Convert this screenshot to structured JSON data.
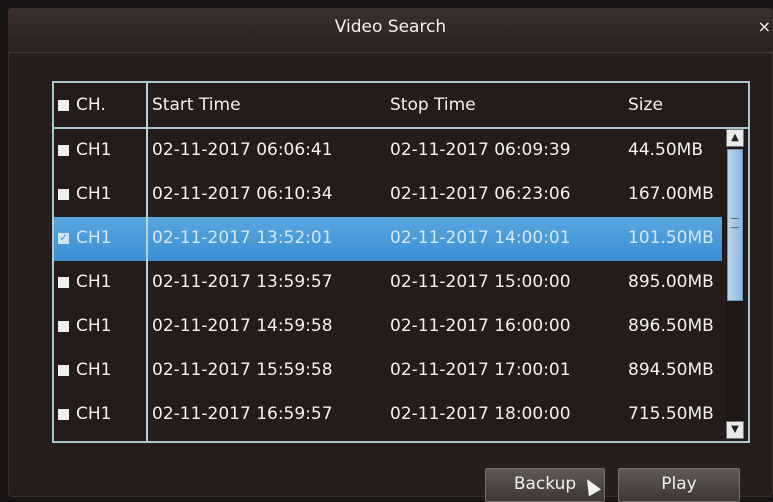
{
  "dialog": {
    "title": "Video Search",
    "close_icon": "×"
  },
  "table": {
    "headers": {
      "channel": "CH.",
      "start": "Start Time",
      "stop": "Stop Time",
      "size": "Size"
    },
    "rows": [
      {
        "channel": "CH1",
        "start": "02-11-2017 06:06:41",
        "stop": "02-11-2017 06:09:39",
        "size": "44.50MB",
        "checked": false
      },
      {
        "channel": "CH1",
        "start": "02-11-2017 06:10:34",
        "stop": "02-11-2017 06:23:06",
        "size": "167.00MB",
        "checked": false
      },
      {
        "channel": "CH1",
        "start": "02-11-2017 13:52:01",
        "stop": "02-11-2017 14:00:01",
        "size": "101.50MB",
        "checked": true
      },
      {
        "channel": "CH1",
        "start": "02-11-2017 13:59:57",
        "stop": "02-11-2017 15:00:00",
        "size": "895.00MB",
        "checked": false
      },
      {
        "channel": "CH1",
        "start": "02-11-2017 14:59:58",
        "stop": "02-11-2017 16:00:00",
        "size": "896.50MB",
        "checked": false
      },
      {
        "channel": "CH1",
        "start": "02-11-2017 15:59:58",
        "stop": "02-11-2017 17:00:01",
        "size": "894.50MB",
        "checked": false
      },
      {
        "channel": "CH1",
        "start": "02-11-2017 16:59:57",
        "stop": "02-11-2017 18:00:00",
        "size": "715.50MB",
        "checked": false
      }
    ]
  },
  "scrollbar": {
    "up_icon": "▲",
    "down_icon": "▼"
  },
  "buttons": {
    "backup": "Backup",
    "play": "Play"
  },
  "colors": {
    "selection": "#3b8fd2",
    "frame": "#a9c8cf",
    "background": "#271d1c"
  }
}
